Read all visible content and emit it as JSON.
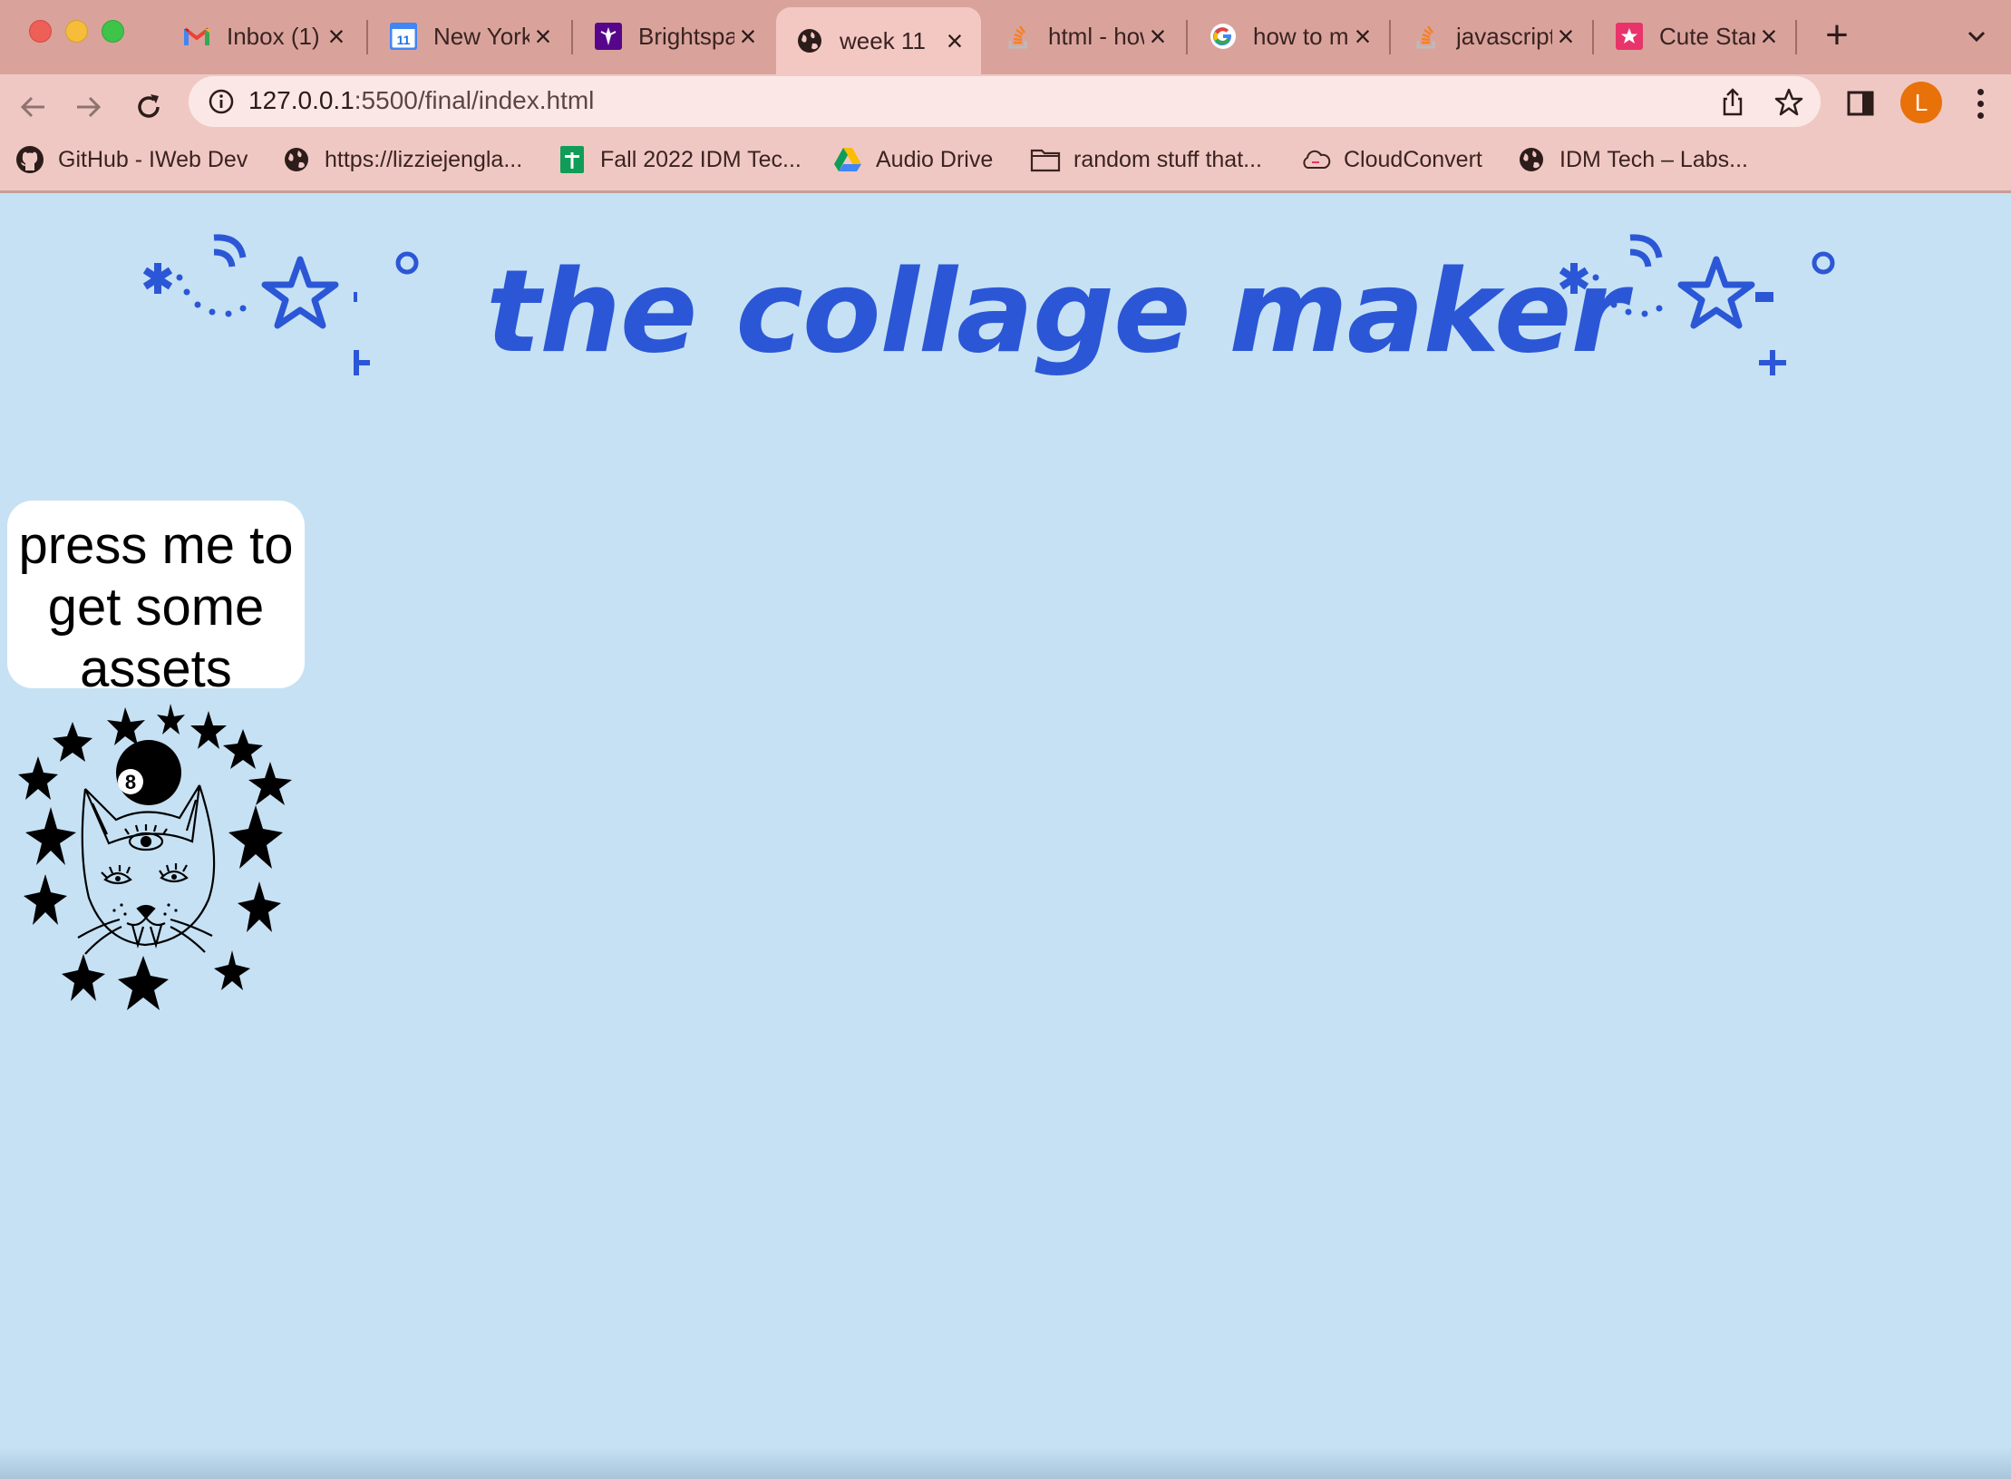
{
  "tabs": [
    {
      "title": "Inbox (1)",
      "icon": "gmail-icon"
    },
    {
      "title": "New York",
      "icon": "calendar-icon"
    },
    {
      "title": "Brightspace",
      "icon": "brightspace-icon"
    },
    {
      "title": "week 11",
      "icon": "globe-icon",
      "active": true
    },
    {
      "title": "html - how",
      "icon": "stackoverflow-icon"
    },
    {
      "title": "how to make",
      "icon": "google-icon"
    },
    {
      "title": "javascript",
      "icon": "stackoverflow-icon"
    },
    {
      "title": "Cute Stars",
      "icon": "star-site-icon"
    }
  ],
  "calendar_badge": "11",
  "address_bar": {
    "host": "127.0.0.1",
    "path": ":5500/final/index.html"
  },
  "profile_initial": "L",
  "bookmarks": [
    {
      "label": "GitHub - IWeb Dev",
      "icon": "github-icon"
    },
    {
      "label": "https://lizziejengla...",
      "icon": "globe-icon"
    },
    {
      "label": "Fall 2022 IDM Tec...",
      "icon": "sheets-icon"
    },
    {
      "label": "Audio Drive",
      "icon": "drive-icon"
    },
    {
      "label": "random stuff that...",
      "icon": "folder-icon"
    },
    {
      "label": "CloudConvert",
      "icon": "cloud-icon"
    },
    {
      "label": "IDM Tech – Labs...",
      "icon": "globe-icon"
    }
  ],
  "page": {
    "title": "the collage maker",
    "button_label": "press me to get some assets",
    "eight_ball_digit": "8"
  },
  "colors": {
    "page_background": "#c6e1f4",
    "title_blue": "#2b57d6",
    "tab_strip": "#d9a39c",
    "toolbar": "#f0c8c3",
    "avatar": "#e8710a"
  }
}
